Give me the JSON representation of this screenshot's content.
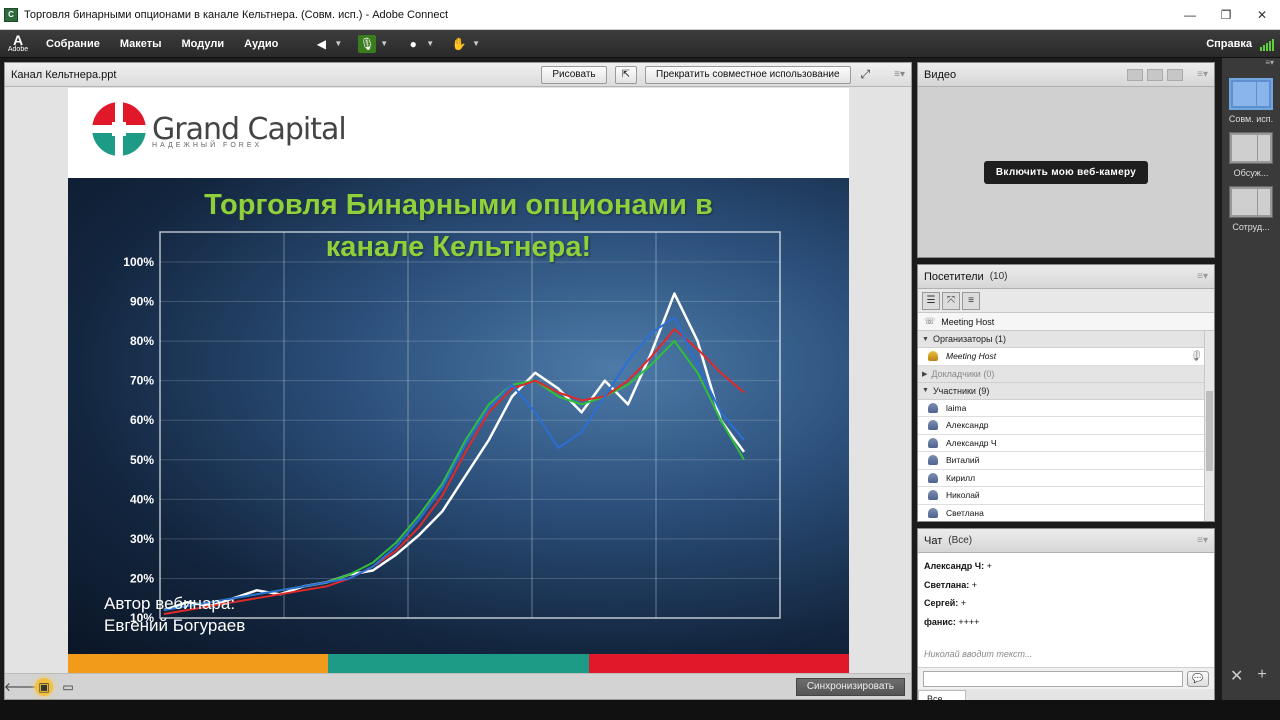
{
  "window": {
    "title": "Торговля бинарными опционами в канале Кельтнера. (Совм. исп.) - Adobe Connect",
    "controls": [
      "—",
      "❐",
      "✕"
    ]
  },
  "menubar": {
    "logo_text": "Adobe",
    "items": [
      "Собрание",
      "Макеты",
      "Модули",
      "Аудио"
    ],
    "help": "Справка"
  },
  "share_pod": {
    "title": "Канал Кельтнера.ppt",
    "draw_button": "Рисовать",
    "stop_sharing_button": "Прекратить совместное использование",
    "sync_button": "Синхронизировать"
  },
  "slide": {
    "brand_name": "Grand Capital",
    "brand_sub": "НАДЕЖНЫЙ FOREX",
    "headline_line1": "Торговля Бинарными опционами в",
    "headline_line2": "канале Кельтнера!",
    "author_line1": "Автор вебинара:",
    "author_line2": "Евгений Богураев",
    "stripe_colors": [
      "#f29a1a",
      "#1e9b87",
      "#e0182a"
    ],
    "headline_color": "#8fd13a"
  },
  "chart_data": {
    "type": "line",
    "ylim": [
      10,
      100
    ],
    "yticks": [
      "100%",
      "90%",
      "80%",
      "70%",
      "60%",
      "50%",
      "40%",
      "30%",
      "20%",
      "10%"
    ],
    "series": [
      {
        "color": "#ffffff",
        "values": [
          12,
          14,
          13,
          15,
          17,
          16,
          18,
          19,
          21,
          22,
          26,
          31,
          37,
          46,
          55,
          66,
          72,
          68,
          62,
          70,
          64,
          77,
          92,
          80,
          60,
          52
        ]
      },
      {
        "color": "#2fbf3a",
        "values": [
          12,
          13,
          14,
          15,
          16,
          17,
          18,
          19,
          21,
          24,
          29,
          36,
          44,
          55,
          64,
          69,
          70,
          66,
          64,
          66,
          69,
          74,
          80,
          72,
          60,
          50
        ]
      },
      {
        "color": "#e02a2a",
        "values": [
          11,
          12,
          13,
          14,
          15,
          16,
          17,
          18,
          20,
          23,
          27,
          33,
          41,
          52,
          62,
          68,
          70,
          67,
          65,
          66,
          70,
          76,
          83,
          78,
          72,
          67
        ]
      },
      {
        "color": "#2a6fd6",
        "values": [
          12,
          13,
          14,
          15,
          16,
          17,
          18,
          19,
          20,
          23,
          28,
          35,
          43,
          54,
          63,
          69,
          62,
          53,
          57,
          66,
          75,
          82,
          86,
          74,
          62,
          55
        ]
      }
    ]
  },
  "video_pod": {
    "title": "Видео",
    "webcam_button": "Включить мою веб-камеру"
  },
  "attendees_pod": {
    "title": "Посетители",
    "count": "(10)",
    "host_status": "Meeting Host",
    "groups": [
      {
        "label": "Организаторы (1)",
        "members": [
          "Meeting Host"
        ]
      },
      {
        "label": "Докладчики (0)",
        "members": []
      },
      {
        "label": "Участники (9)",
        "members": [
          "laima",
          "Александр",
          "Александр Ч",
          "Виталий",
          "Кирилл",
          "Николай",
          "Светлана"
        ]
      }
    ]
  },
  "chat_pod": {
    "title": "Чат",
    "scope": "(Все)",
    "messages": [
      {
        "author": "Александр Ч:",
        "text": "+"
      },
      {
        "author": "Светлана:",
        "text": "+"
      },
      {
        "author": "Сергей:",
        "text": "+"
      },
      {
        "author": "фанис:",
        "text": "++++"
      }
    ],
    "typing": "Николай вводит текст...",
    "tab": "Все"
  },
  "layouts": {
    "items": [
      "Совм. исп.",
      "Обсуж...",
      "Сотруд..."
    ],
    "active": "Совм. исп."
  }
}
